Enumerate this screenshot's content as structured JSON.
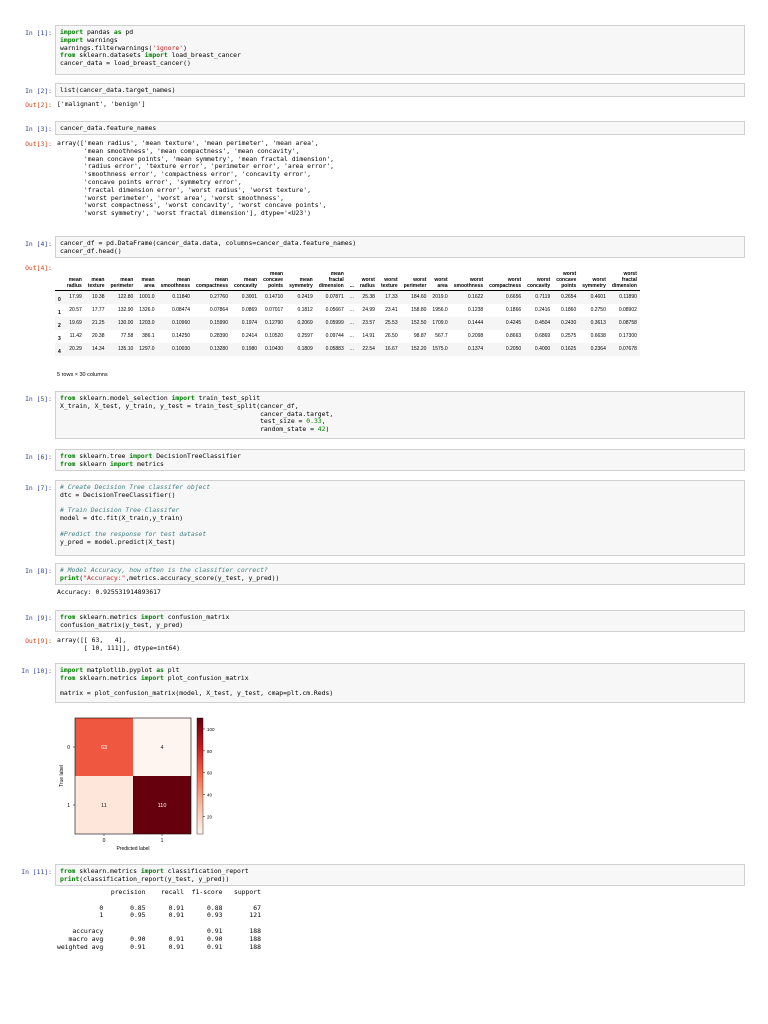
{
  "cells": {
    "c1": {
      "prompt": "In [1]:"
    },
    "c2": {
      "prompt": "In [2]:",
      "code": "list(cancer_data.target_names)",
      "out_prompt": "Out[2]:",
      "out": "['malignant', 'benign']"
    },
    "c3": {
      "prompt": "In [3]:",
      "code": "cancer_data.feature_names",
      "out_prompt": "Out[3]:",
      "out": "array(['mean radius', 'mean texture', 'mean perimeter', 'mean area',\n       'mean smoothness', 'mean compactness', 'mean concavity',\n       'mean concave points', 'mean symmetry', 'mean fractal dimension',\n       'radius error', 'texture error', 'perimeter error', 'area error',\n       'smoothness error', 'compactness error', 'concavity error',\n       'concave points error', 'symmetry error',\n       'fractal dimension error', 'worst radius', 'worst texture',\n       'worst perimeter', 'worst area', 'worst smoothness',\n       'worst compactness', 'worst concavity', 'worst concave points',\n       'worst symmetry', 'worst fractal dimension'], dtype='<U23')"
    },
    "c4": {
      "prompt": "In [4]:",
      "out_prompt": "Out[4]:",
      "rows_note": "5 rows × 30 columns"
    },
    "c5": {
      "prompt": "In [5]:"
    },
    "c6": {
      "prompt": "In [6]:"
    },
    "c7": {
      "prompt": "In [7]:"
    },
    "c8": {
      "prompt": "In [8]:",
      "out": "Accuracy: 0.925531914893617"
    },
    "c9": {
      "prompt": "In [9]:",
      "out_prompt": "Out[9]:",
      "out": "array([[ 63,   4],\n       [ 10, 111]], dtype=int64)"
    },
    "c10": {
      "prompt": "In [10]:"
    },
    "c11": {
      "prompt": "In [11]:",
      "out": "              precision    recall  f1-score   support\n\n           0       0.85      0.91      0.88        67\n           1       0.95      0.91      0.93       121\n\n    accuracy                           0.91       188\n   macro avg       0.90      0.91      0.90       188\nweighted avg       0.91      0.91      0.91       188"
    }
  },
  "dataframe": {
    "columns": [
      "mean\nradius",
      "mean\ntexture",
      "mean\nperimeter",
      "mean\narea",
      "mean\nsmoothness",
      "mean\ncompactness",
      "mean\nconcavity",
      "mean\nconcave\npoints",
      "mean\nsymmetry",
      "mean\nfractal\ndimension",
      "...",
      "worst\nradius",
      "worst\ntexture",
      "worst\nperimeter",
      "worst\narea",
      "worst\nsmoothness",
      "worst\ncompactness",
      "worst\nconcavity",
      "worst\nconcave\npoints",
      "worst\nsymmetry",
      "worst\nfractal\ndimension"
    ],
    "index": [
      "0",
      "1",
      "2",
      "3",
      "4"
    ],
    "rows": [
      [
        "17.99",
        "10.38",
        "122.80",
        "1001.0",
        "0.11840",
        "0.27760",
        "0.3001",
        "0.14710",
        "0.2419",
        "0.07871",
        "...",
        "25.38",
        "17.33",
        "184.60",
        "2019.0",
        "0.1622",
        "0.6656",
        "0.7119",
        "0.2654",
        "0.4601",
        "0.11890"
      ],
      [
        "20.57",
        "17.77",
        "132.90",
        "1326.0",
        "0.08474",
        "0.07864",
        "0.0869",
        "0.07017",
        "0.1812",
        "0.05667",
        "...",
        "24.99",
        "23.41",
        "158.80",
        "1956.0",
        "0.1238",
        "0.1866",
        "0.2416",
        "0.1860",
        "0.2750",
        "0.08902"
      ],
      [
        "19.69",
        "21.25",
        "130.00",
        "1203.0",
        "0.10960",
        "0.15990",
        "0.1974",
        "0.12790",
        "0.2069",
        "0.05999",
        "...",
        "23.57",
        "25.53",
        "152.50",
        "1709.0",
        "0.1444",
        "0.4245",
        "0.4504",
        "0.2430",
        "0.3613",
        "0.08758"
      ],
      [
        "11.42",
        "20.38",
        "77.58",
        "386.1",
        "0.14250",
        "0.28390",
        "0.2414",
        "0.10520",
        "0.2597",
        "0.09744",
        "...",
        "14.91",
        "26.50",
        "98.87",
        "567.7",
        "0.2098",
        "0.8663",
        "0.6869",
        "0.2575",
        "0.6638",
        "0.17300"
      ],
      [
        "20.29",
        "14.34",
        "135.10",
        "1297.0",
        "0.10030",
        "0.13280",
        "0.1980",
        "0.10430",
        "0.1809",
        "0.05883",
        "...",
        "22.54",
        "16.67",
        "152.20",
        "1575.0",
        "0.1374",
        "0.2050",
        "0.4000",
        "0.1625",
        "0.2364",
        "0.07678"
      ]
    ]
  },
  "chart_data": {
    "type": "heatmap",
    "matrix": [
      [
        63,
        4
      ],
      [
        11,
        110
      ]
    ],
    "x_ticks": [
      "0",
      "1"
    ],
    "y_ticks": [
      "0",
      "1"
    ],
    "xlabel": "Predicted label",
    "ylabel": "True label",
    "colorbar_ticks": [
      100,
      80,
      60,
      40,
      20
    ],
    "colorbar_range": [
      4,
      110
    ],
    "cmap": "Reds"
  },
  "colors": {
    "prompt_in": "#303f9f",
    "prompt_out": "#d84315",
    "keyword": "#008000",
    "string": "#ba2121",
    "comment": "#408080"
  }
}
